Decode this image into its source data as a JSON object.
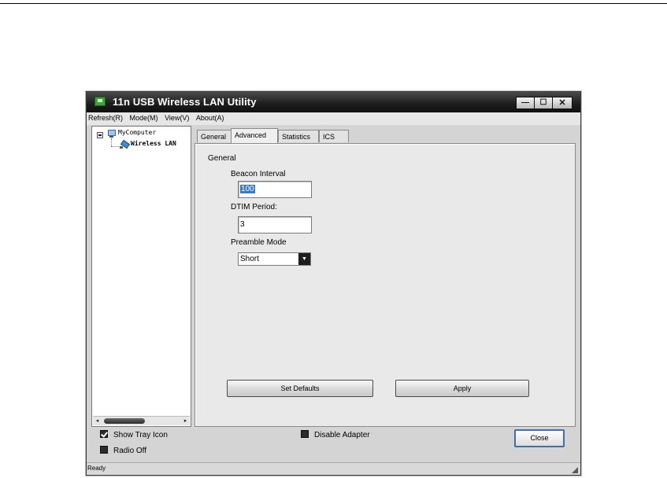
{
  "window": {
    "title": "11n USB Wireless LAN Utility",
    "controls": {
      "minimize": "—",
      "maximize": "☐",
      "close": "✕"
    }
  },
  "menu": [
    "Refresh(R)",
    "Mode(M)",
    "View(V)",
    "About(A)"
  ],
  "tree": {
    "root": "MyComputer",
    "child": "Wireless LAN"
  },
  "scroll": {
    "left_arrow": "◂",
    "right_arrow": "▸"
  },
  "tabs": [
    {
      "label": "General",
      "active": false
    },
    {
      "label": "Advanced",
      "active": true
    },
    {
      "label": "Statistics",
      "active": false
    },
    {
      "label": "ICS",
      "active": false
    }
  ],
  "advanced": {
    "group_label": "General",
    "beacon_label": "Beacon Interval",
    "beacon_value": "100",
    "dtim_label": "DTIM Period:",
    "dtim_value": "3",
    "preamble_label": "Preamble Mode",
    "preamble_value": "Short",
    "dropdown_arrow": "▼",
    "set_defaults": "Set Defaults",
    "apply": "Apply"
  },
  "footer": {
    "show_tray_icon": {
      "label": "Show Tray Icon",
      "checked": true
    },
    "radio_off": {
      "label": "Radio Off",
      "checked": false
    },
    "disable_adapter": {
      "label": "Disable Adapter",
      "checked": false
    },
    "close": "Close"
  },
  "status": "Ready",
  "colors": {
    "titlebar": "#1f1f1f",
    "selection": "#3a78c9",
    "close_border": "#3c6fae"
  },
  "icons": [
    "app-icon",
    "computer-icon",
    "wireless-adapter-icon",
    "dropdown-arrow-icon",
    "size-grip-icon"
  ]
}
